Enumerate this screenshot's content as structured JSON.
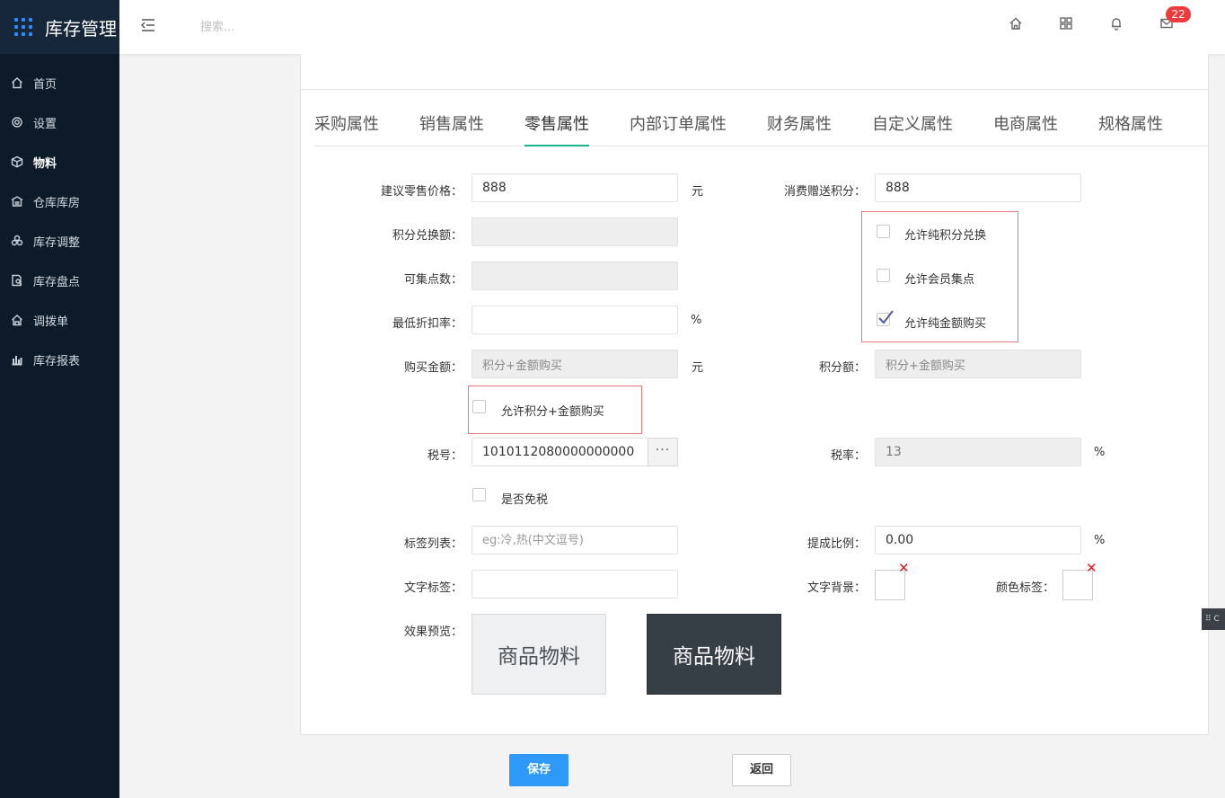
{
  "app": {
    "title": "库存管理"
  },
  "sidebar": {
    "items": [
      {
        "label": "首页",
        "icon": "home-icon"
      },
      {
        "label": "设置",
        "icon": "gear-icon"
      },
      {
        "label": "物料",
        "icon": "cube-icon",
        "active": true
      },
      {
        "label": "仓库库房",
        "icon": "warehouse-icon"
      },
      {
        "label": "库存调整",
        "icon": "adjust-icon"
      },
      {
        "label": "库存盘点",
        "icon": "inventory-icon"
      },
      {
        "label": "调拨单",
        "icon": "transfer-icon"
      },
      {
        "label": "库存报表",
        "icon": "bar-chart-icon"
      }
    ]
  },
  "header": {
    "search_placeholder": "搜索...",
    "mail_count": "22",
    "icons": [
      "home-icon",
      "apps-icon",
      "bell-icon",
      "mail-icon"
    ]
  },
  "tabs": [
    {
      "label": "采购属性"
    },
    {
      "label": "销售属性"
    },
    {
      "label": "零售属性",
      "active": true
    },
    {
      "label": "内部订单属性"
    },
    {
      "label": "财务属性"
    },
    {
      "label": "自定义属性"
    },
    {
      "label": "电商属性"
    },
    {
      "label": "规格属性"
    }
  ],
  "form": {
    "suggested_price": {
      "label": "建议零售价格：",
      "value": "888",
      "unit": "元"
    },
    "points_reward": {
      "label": "消费赠送积分：",
      "value": "888"
    },
    "points_exchange": {
      "label": "积分兑换额：",
      "value": ""
    },
    "collect_points": {
      "label": "可集点数：",
      "value": ""
    },
    "min_discount": {
      "label": "最低折扣率：",
      "value": "",
      "unit": "%"
    },
    "allow_pure_points": {
      "label": "允许纯积分兑换",
      "checked": false
    },
    "allow_member_collect": {
      "label": "允许会员集点",
      "checked": false
    },
    "allow_pure_cash": {
      "label": "允许纯金额购买",
      "checked": true
    },
    "purchase_amount": {
      "label": "购买金额：",
      "value": "积分+金额购买",
      "unit": "元"
    },
    "points_amount": {
      "label": "积分额：",
      "value": "积分+金额购买"
    },
    "allow_points_cash": {
      "label": "允许积分+金额购买",
      "checked": false
    },
    "tax_code": {
      "label": "税号：",
      "value": "1010112080000000000",
      "button": "···"
    },
    "tax_rate": {
      "label": "税率：",
      "value": "13",
      "unit": "%"
    },
    "tax_exempt": {
      "label": "是否免税",
      "checked": false
    },
    "tag_list": {
      "label": "标签列表：",
      "placeholder": "eg:冷,热(中文逗号)"
    },
    "commission": {
      "label": "提成比例：",
      "value": "0.00",
      "unit": "%"
    },
    "text_tag": {
      "label": "文字标签：",
      "value": ""
    },
    "text_bg": {
      "label": "文字背景："
    },
    "color_tag": {
      "label": "颜色标签："
    },
    "preview": {
      "label": "效果预览：",
      "light_text": "商品物料",
      "dark_text": "商品物料"
    },
    "clear_mark": "✕"
  },
  "actions": {
    "save": "保存",
    "back": "返回"
  },
  "side_handle": {
    "label": "⠿ C"
  }
}
